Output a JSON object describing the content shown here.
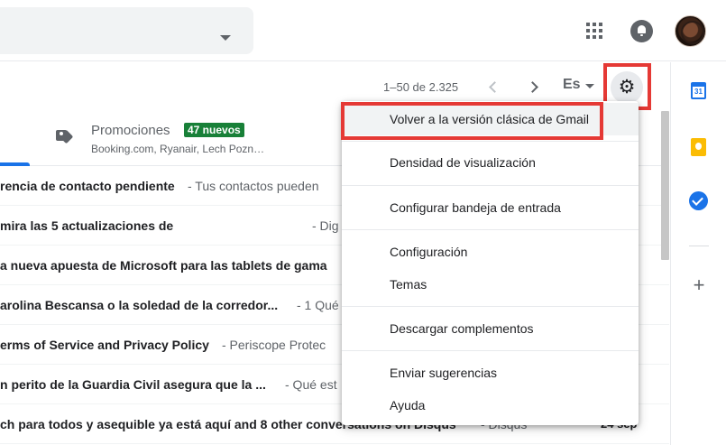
{
  "header": {
    "apps_icon": "apps-grid-icon",
    "notifications_icon": "bell-icon",
    "avatar": "account-avatar"
  },
  "toolbar": {
    "page_count": "1–50 de 2.325",
    "language": "Es",
    "settings_icon": "gear-icon"
  },
  "tabs": {
    "promotions": {
      "title": "Promociones",
      "badge": "47 nuevos",
      "senders": "Booking.com, Ryanair, Lech Pozn…",
      "icon": "tag-icon"
    }
  },
  "emails": [
    {
      "subject": "rencia de contacto pendiente",
      "snippet": " - Tus contactos pueden"
    },
    {
      "subject": "mira las 5 actualizaciones de",
      "snippet": "- Dig"
    },
    {
      "subject": "a nueva apuesta de Microsoft para las tablets de gama",
      "snippet": ""
    },
    {
      "subject": "arolina Bescansa o la soledad de la corredor...",
      "snippet": " - 1 Qué"
    },
    {
      "subject": "erms of Service and Privacy Policy",
      "snippet": " - Periscope Protec"
    },
    {
      "subject": "n perito de la Guardia Civil asegura que la ...",
      "snippet": " - Qué est"
    },
    {
      "subject": "ch para todos y asequible ya está aquí and 8 other conversations on Disqus",
      "snippet": " - Disqus",
      "date": "24 sep"
    }
  ],
  "menu": {
    "items": [
      {
        "label": "Volver a la versión clásica de Gmail",
        "highlighted": true
      },
      {
        "label": "Densidad de visualización"
      },
      {
        "label": "Configurar bandeja de entrada"
      },
      {
        "label": "Configuración"
      },
      {
        "label": "Temas"
      },
      {
        "label": "Descargar complementos"
      },
      {
        "label": "Enviar sugerencias"
      },
      {
        "label": "Ayuda"
      }
    ]
  },
  "side_panel": {
    "icons": [
      "calendar-icon",
      "keep-icon",
      "tasks-icon",
      "add-icon"
    ]
  },
  "colors": {
    "highlight_border": "#e53935",
    "badge_green": "#188038",
    "accent_blue": "#1a73e8"
  }
}
